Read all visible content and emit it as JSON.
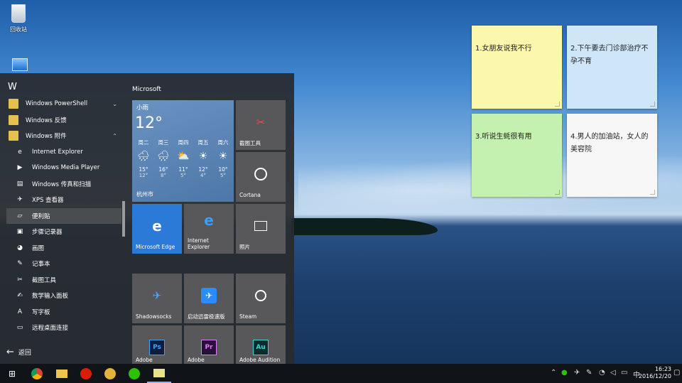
{
  "desktop": {
    "recycle_bin_label": "回收站"
  },
  "notes": [
    {
      "text": "1.女朋友说我不行",
      "color": "#fbf7ad"
    },
    {
      "text": "2.下午要去门诊部治疗不孕不育",
      "color": "#cfe6f9"
    },
    {
      "text": "3.听说生蚝很有用",
      "color": "#c4f0b0"
    },
    {
      "text": "4.男人的加油站，女人的美容院",
      "color": "#f7f7f7"
    }
  ],
  "start_menu": {
    "letter": "W",
    "items": [
      {
        "label": "Windows PowerShell",
        "type": "folder",
        "chevron": "⌄"
      },
      {
        "label": "Windows 反馈",
        "type": "folder",
        "chevron": ""
      },
      {
        "label": "Windows 附件",
        "type": "folder",
        "chevron": "⌃"
      },
      {
        "label": "Internet Explorer",
        "type": "app",
        "icon": "e"
      },
      {
        "label": "Windows Media Player",
        "type": "app",
        "icon": "▶"
      },
      {
        "label": "Windows 传真和扫描",
        "type": "app",
        "icon": "▤"
      },
      {
        "label": "XPS 查看器",
        "type": "app",
        "icon": "✈"
      },
      {
        "label": "便利贴",
        "type": "app",
        "icon": "▱"
      },
      {
        "label": "步骤记录器",
        "type": "app",
        "icon": "▣"
      },
      {
        "label": "画图",
        "type": "app",
        "icon": "◕"
      },
      {
        "label": "记事本",
        "type": "app",
        "icon": "✎"
      },
      {
        "label": "截图工具",
        "type": "app",
        "icon": "✂"
      },
      {
        "label": "数学输入面板",
        "type": "app",
        "icon": "✍"
      },
      {
        "label": "写字板",
        "type": "app",
        "icon": "A"
      },
      {
        "label": "远程桌面连接",
        "type": "app",
        "icon": "▭"
      }
    ],
    "back_label": "返回"
  },
  "tiles": {
    "group_title": "Microsoft",
    "weather": {
      "condition": "小雨",
      "temperature": "12°",
      "city": "杭州市",
      "days": [
        {
          "day": "周二",
          "icon": "🌧",
          "hi": "15°",
          "lo": "12°"
        },
        {
          "day": "周三",
          "icon": "🌧",
          "hi": "16°",
          "lo": "8°"
        },
        {
          "day": "周四",
          "icon": "⛅",
          "hi": "11°",
          "lo": "5°"
        },
        {
          "day": "周五",
          "icon": "☀",
          "hi": "12°",
          "lo": "4°"
        },
        {
          "day": "周六",
          "icon": "☀",
          "hi": "10°",
          "lo": "5°"
        }
      ]
    },
    "snipping": "截图工具",
    "cortana": "Cortana",
    "edge": "Microsoft Edge",
    "ie": "Internet Explorer",
    "photos": "照片",
    "shadowsocks": "Shadowsocks",
    "xunlei": "启动迅雷极速版",
    "steam": "Steam",
    "adobe_ps": "Adobe",
    "adobe_pr": "Adobe",
    "adobe_au": "Adobe Audition"
  },
  "taskbar": {
    "time": "16:23",
    "date": "2016/12/20",
    "ime": "中"
  }
}
